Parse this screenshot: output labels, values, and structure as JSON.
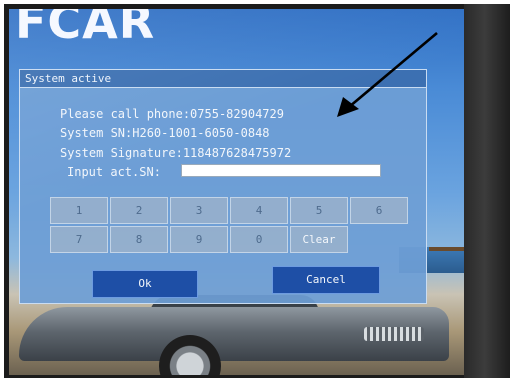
{
  "screen": {
    "logo_text": "FCAR"
  },
  "dialog": {
    "title": "System active",
    "phone_line": "Please call phone:0755-82904729",
    "sn_line": "System SN:H260-1001-6050-0848",
    "signature_line": "System Signature:118487628475972",
    "input_label": "Input act.SN:",
    "input_value": "",
    "keypad": [
      "1",
      "2",
      "3",
      "4",
      "5",
      "6",
      "7",
      "8",
      "9",
      "0",
      "Clear"
    ],
    "ok_label": "Ok",
    "cancel_label": "Cancel"
  },
  "colors": {
    "dialog_bg": "#6e9ed5",
    "button_bg": "#1e4fa6",
    "arrow": "#000000"
  },
  "annotations": {
    "arrow_icon": "arrow-pointing-at-phone-number"
  }
}
